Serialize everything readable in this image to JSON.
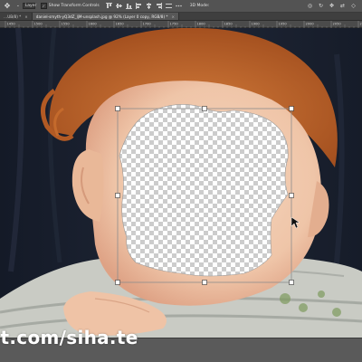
{
  "options_bar": {
    "auto_select_label": "Layer",
    "transform_controls_label": "Show Transform Controls",
    "transform_controls_checked": true,
    "mode_3d_label": "3D Mode:"
  },
  "tabs": [
    {
      "label": "…UB/8) *",
      "active": false
    },
    {
      "label": "daniel-smyth-yQ3dZ_ljM-unsplash.jpg @ 92% (Layer 0 copy, RGB/8) *",
      "active": true
    }
  ],
  "ruler": {
    "labels": [
      "1450",
      "1500",
      "1550",
      "1600",
      "1650",
      "1700",
      "1750",
      "1800",
      "1850",
      "1900",
      "1950",
      "2000",
      "2050",
      "2100"
    ]
  },
  "canvas": {
    "colors": {
      "backdrop": "#1c2231",
      "hair": "#c1692f",
      "skin": "#efc5a8",
      "shirt": "#c9cbc4",
      "transparency_light": "#ffffff",
      "transparency_dark": "#cccccc"
    }
  },
  "watermark": {
    "text": "ut.com/siha.te"
  }
}
